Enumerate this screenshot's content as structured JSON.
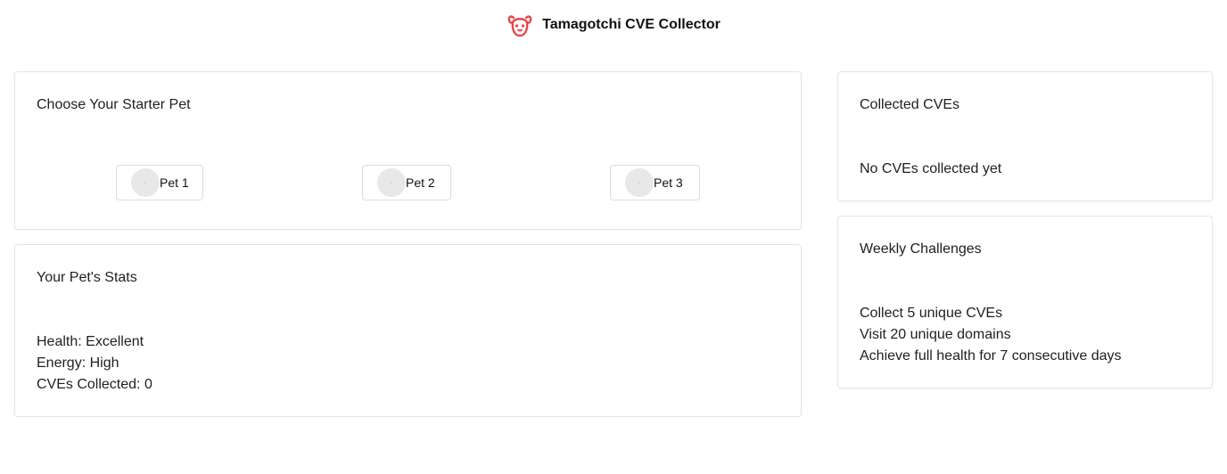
{
  "header": {
    "title": "Tamagotchi CVE Collector",
    "logo_icon": "dog-face-icon",
    "accent_color": "#e5484d"
  },
  "starter": {
    "title": "Choose Your Starter Pet",
    "pets": [
      {
        "label": "Pet 1"
      },
      {
        "label": "Pet 2"
      },
      {
        "label": "Pet 3"
      }
    ]
  },
  "stats": {
    "title": "Your Pet's Stats",
    "health": "Health: Excellent",
    "energy": "Energy: High",
    "cves": "CVEs Collected: 0"
  },
  "collected": {
    "title": "Collected CVEs",
    "empty_text": "No CVEs collected yet"
  },
  "challenges": {
    "title": "Weekly Challenges",
    "items": [
      "Collect 5 unique CVEs",
      "Visit 20 unique domains",
      "Achieve full health for 7 consecutive days"
    ]
  }
}
